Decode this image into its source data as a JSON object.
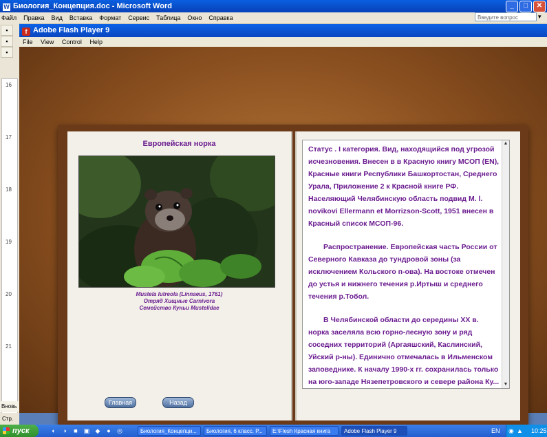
{
  "word": {
    "title": "Биология_Концепция.doc - Microsoft Word",
    "menu": [
      "Файл",
      "Правка",
      "Вид",
      "Вставка",
      "Формат",
      "Сервис",
      "Таблица",
      "Окно",
      "Справка"
    ],
    "help_placeholder": "Введите вопрос",
    "ruler_numbers": [
      "16",
      "17",
      "18",
      "19",
      "20",
      "21"
    ],
    "status_left": "Стр.",
    "status_left2": "Вновь"
  },
  "flash": {
    "title": "Adobe Flash Player 9",
    "menu": [
      "File",
      "View",
      "Control",
      "Help"
    ]
  },
  "book": {
    "left": {
      "title": "Европейская норка",
      "caption_latin": "Mustela lutreola (Linnaeus, 1761)",
      "caption_order": "Отряд Хищные Carnivora",
      "caption_family": "Семейство Куньи Mustelidae",
      "btn_main": "Главная",
      "btn_back": "Назад"
    },
    "right": {
      "p1": "Статус . I категория. Вид, находящийся под угрозой исчезновения. Внесен в в Красную книгу МСОП (EN), Красные книги Республики Башкортостан, Среднего Урала, Приложение 2 к Красной книге РФ. Населяющий Челябинскую область подвид M. l. novikovi Ellermann et Morrizson-Scott, 1951 внесен в Красный список МСОП-96.",
      "p2": "Распространение. Европейская часть России от Северного Кавказа до тундровой зоны (за исключением Кольского п-ова). На востоке отмечен до устья и нижнего течения р.Иртыш и среднего течения р.Тобол.",
      "p3": "В Челябинской области до середины XX в. норка заселяла всю горно-лесную зону и ряд соседних территорий (Аргаяшский, Каслинский, Уйский р-ны). Единично отмечалась в Ильменском заповеднике. К началу 1990-х гг. сохранилась только на юго-западе Нязепетровского и севере района Ку..."
    }
  },
  "taskbar": {
    "start": "пуск",
    "tasks": [
      "Биология_Концепци...",
      "Биология, 6 класс. Р...",
      "E:\\Flesh Красная книга",
      "Adobe Flash Player 9"
    ],
    "lang": "EN",
    "clock": "10:25"
  }
}
